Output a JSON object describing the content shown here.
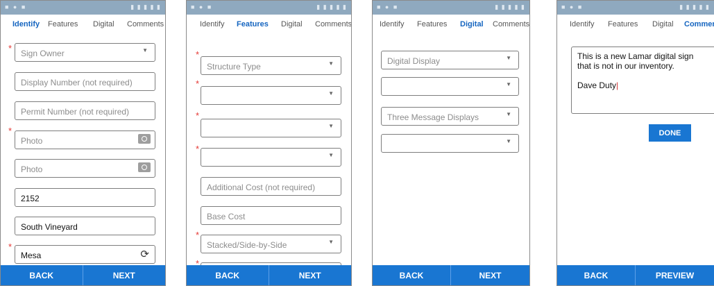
{
  "statusbar": {
    "left": "■ ● ■",
    "right": "▮ ▮ ▮ ▮ ▮"
  },
  "tabs": {
    "identify": "Identify",
    "features": "Features",
    "digital": "Digital",
    "comments": "Comments",
    "comments_truncated": "Comment"
  },
  "screen1": {
    "sign_owner": "Sign Owner",
    "display_number": "Display Number (not required)",
    "permit_number": "Permit Number (not required)",
    "photo_1": "Photo",
    "photo_2": "Photo",
    "number_value": "2152",
    "street_value": "South Vineyard",
    "city_value": "Mesa"
  },
  "screen2": {
    "structure_type": "Structure Type",
    "blank_1": "",
    "blank_2": "",
    "blank_3": "",
    "additional_cost": "Additional Cost (not required)",
    "base_cost": "Base Cost",
    "stacked": "Stacked/Side-by-Side"
  },
  "screen3": {
    "digital_display": "Digital Display",
    "blank_1": "",
    "three_message": "Three Message Displays",
    "blank_2": ""
  },
  "screen4": {
    "comment_line1": "This is a new Lamar digital sign",
    "comment_line2": "that is not in our inventory.",
    "comment_sign": "Dave Duty",
    "done": "DONE"
  },
  "nav": {
    "back": "BACK",
    "next": "NEXT",
    "preview": "PREVIEW"
  },
  "colors": {
    "accent": "#1976d2",
    "required": "#e53935",
    "corner": "#7cb342"
  }
}
